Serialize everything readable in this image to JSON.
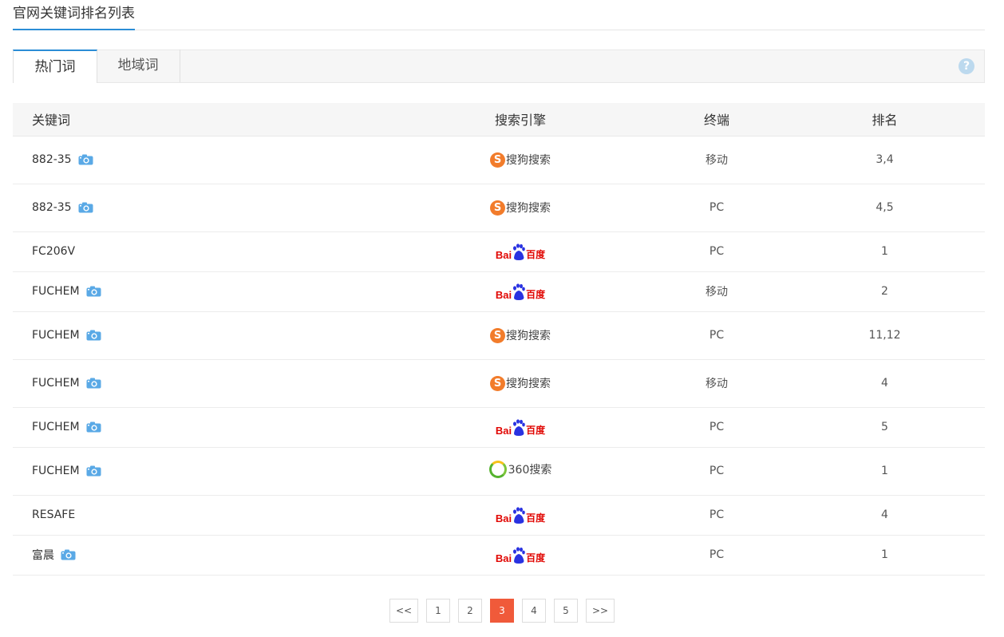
{
  "page": {
    "title": "官网关键词排名列表"
  },
  "tabs": [
    {
      "label": "热门词",
      "active": true
    },
    {
      "label": "地域词",
      "active": false
    }
  ],
  "help": {
    "icon": "help-icon",
    "glyph": "?"
  },
  "table": {
    "columns": [
      "关键词",
      "搜索引擎",
      "终端",
      "排名"
    ],
    "rows": [
      {
        "keyword": "882-35",
        "snapshot": true,
        "engine": "sogou",
        "terminal": "移动",
        "rank": "3,4"
      },
      {
        "keyword": "882-35",
        "snapshot": true,
        "engine": "sogou",
        "terminal": "PC",
        "rank": "4,5"
      },
      {
        "keyword": "FC206V",
        "snapshot": false,
        "engine": "baidu",
        "terminal": "PC",
        "rank": "1"
      },
      {
        "keyword": "FUCHEM",
        "snapshot": true,
        "engine": "baidu",
        "terminal": "移动",
        "rank": "2"
      },
      {
        "keyword": "FUCHEM",
        "snapshot": true,
        "engine": "sogou",
        "terminal": "PC",
        "rank": "11,12"
      },
      {
        "keyword": "FUCHEM",
        "snapshot": true,
        "engine": "sogou",
        "terminal": "移动",
        "rank": "4"
      },
      {
        "keyword": "FUCHEM",
        "snapshot": true,
        "engine": "baidu",
        "terminal": "PC",
        "rank": "5"
      },
      {
        "keyword": "FUCHEM",
        "snapshot": true,
        "engine": "360",
        "terminal": "PC",
        "rank": "1"
      },
      {
        "keyword": "RESAFE",
        "snapshot": false,
        "engine": "baidu",
        "terminal": "PC",
        "rank": "4"
      },
      {
        "keyword": "富晨",
        "snapshot": true,
        "engine": "baidu",
        "terminal": "PC",
        "rank": "1"
      }
    ]
  },
  "engines": {
    "sogou": {
      "mark": "S",
      "text": "搜狗搜索",
      "color": "#f27c2b"
    },
    "baidu": {
      "bai": "Bai",
      "du": "du",
      "text": "百度",
      "color": "#e10602",
      "paw_color": "#2932e1"
    },
    "360": {
      "text": "360搜索",
      "color": "#55b32e"
    }
  },
  "pagination": {
    "prev": "<<",
    "next": ">>",
    "pages": [
      "1",
      "2",
      "3",
      "4",
      "5"
    ],
    "current": "3",
    "accent": "#f05a3a"
  }
}
